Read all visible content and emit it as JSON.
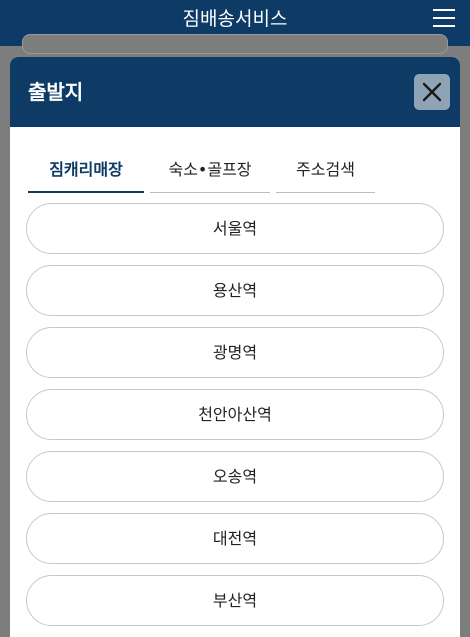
{
  "app": {
    "title": "짐배송서비스",
    "menu_icon": "hamburger-menu-icon"
  },
  "modal": {
    "title": "출발지",
    "close_icon": "close-icon"
  },
  "tabs": [
    {
      "label": "짐캐리매장",
      "active": true
    },
    {
      "label": "숙소•골프장",
      "active": false
    },
    {
      "label": "주소검색",
      "active": false
    }
  ],
  "stations": [
    {
      "label": "서울역"
    },
    {
      "label": "용산역"
    },
    {
      "label": "광명역"
    },
    {
      "label": "천안아산역"
    },
    {
      "label": "오송역"
    },
    {
      "label": "대전역"
    },
    {
      "label": "부산역"
    }
  ],
  "colors": {
    "header": "#0d3b66",
    "close_button": "#8fa3b6",
    "overlay": "#7d7d7d"
  }
}
